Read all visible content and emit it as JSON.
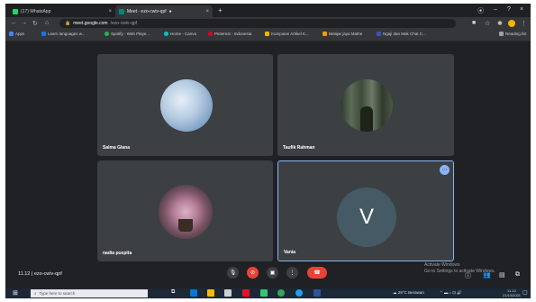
{
  "tabs": [
    {
      "label": "(17) WhatsApp",
      "icon": "whatsapp-icon",
      "color": "#25d366"
    },
    {
      "label": "Meet - ezo-cwiv-qpf",
      "icon": "meet-icon",
      "color": "#00897b"
    }
  ],
  "address": {
    "host": "meet.google.com",
    "path": "/ezo-cwiv-qpf"
  },
  "bookmarks": [
    {
      "label": "Apps",
      "color": "#4285f4"
    },
    {
      "label": "Learn languages w...",
      "color": "#1a73e8"
    },
    {
      "label": "Spotify - Web Playe...",
      "color": "#1db954"
    },
    {
      "label": "Home - Canva",
      "color": "#00c4cc"
    },
    {
      "label": "Pinterest - Indonesia",
      "color": "#e60023"
    },
    {
      "label": "Kumpulan Artikel K...",
      "color": "#f4b400"
    },
    {
      "label": "Belajar jaya Mathe",
      "color": "#ff9800"
    },
    {
      "label": "Ngaji dan Mak Chat C...",
      "color": "#3f51b5"
    },
    {
      "label": "Reading list",
      "color": "#9aa0a6"
    }
  ],
  "participants": [
    {
      "name": "Salma Glana",
      "avatar": "sky-photo-avatar"
    },
    {
      "name": "Taufik Rahman",
      "avatar": "forest-photo-avatar"
    },
    {
      "name": "nadia puspita",
      "avatar": "flowers-photo-avatar"
    },
    {
      "name": "Vania",
      "avatar": "letter-avatar",
      "initial": "V"
    }
  ],
  "meeting": {
    "time": "11.12",
    "code": "ezo-cwiv-qpf",
    "separator": "|"
  },
  "watermark": {
    "line1": "Activate Windows",
    "line2": "Go to Settings to activate Windows."
  },
  "taskbar": {
    "search_placeholder": "Type here to search",
    "weather": "29°C Berawan",
    "time": "11.12",
    "date": "21/10/2021"
  },
  "colors": {
    "accent": "#8ab4f8",
    "end_call": "#ea4335",
    "tile": "#3c4043"
  }
}
